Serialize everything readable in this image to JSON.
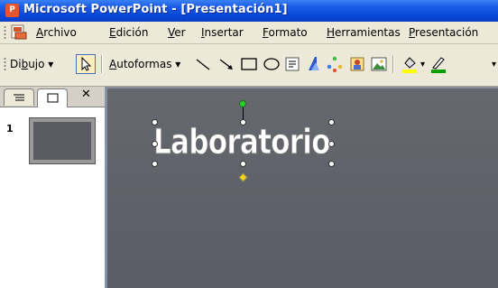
{
  "window": {
    "title": "Microsoft PowerPoint - [Presentación1]",
    "app_icon": "powerpoint-icon"
  },
  "menubar": {
    "items": [
      {
        "label": "Archivo",
        "mnemonic": "A"
      },
      {
        "label": "Edición",
        "mnemonic": "E"
      },
      {
        "label": "Ver",
        "mnemonic": "V"
      },
      {
        "label": "Insertar",
        "mnemonic": "I"
      },
      {
        "label": "Formato",
        "mnemonic": "F"
      },
      {
        "label": "Herramientas",
        "mnemonic": "H"
      },
      {
        "label": "Presentación",
        "mnemonic": "P"
      }
    ]
  },
  "drawing_toolbar": {
    "dibujo_label": "Dibujo",
    "autoformas_label": "Autoformas",
    "tools": [
      "select-arrow-icon",
      "line-icon",
      "arrow-icon",
      "rectangle-icon",
      "oval-icon",
      "textbox-icon",
      "wordart-icon",
      "diagram-icon",
      "clipart-icon",
      "picture-icon",
      "fill-color-icon",
      "line-color-icon"
    ],
    "accent_colors": {
      "fill_bar": "#ffff00",
      "line_bar": "#00a000"
    }
  },
  "left_panel": {
    "slide_number": "1"
  },
  "slide": {
    "title": "Laboratorio"
  },
  "colors": {
    "titlebar": "#0a48d8",
    "chrome": "#ece9d8",
    "slide_bg": "#5d5f69"
  }
}
